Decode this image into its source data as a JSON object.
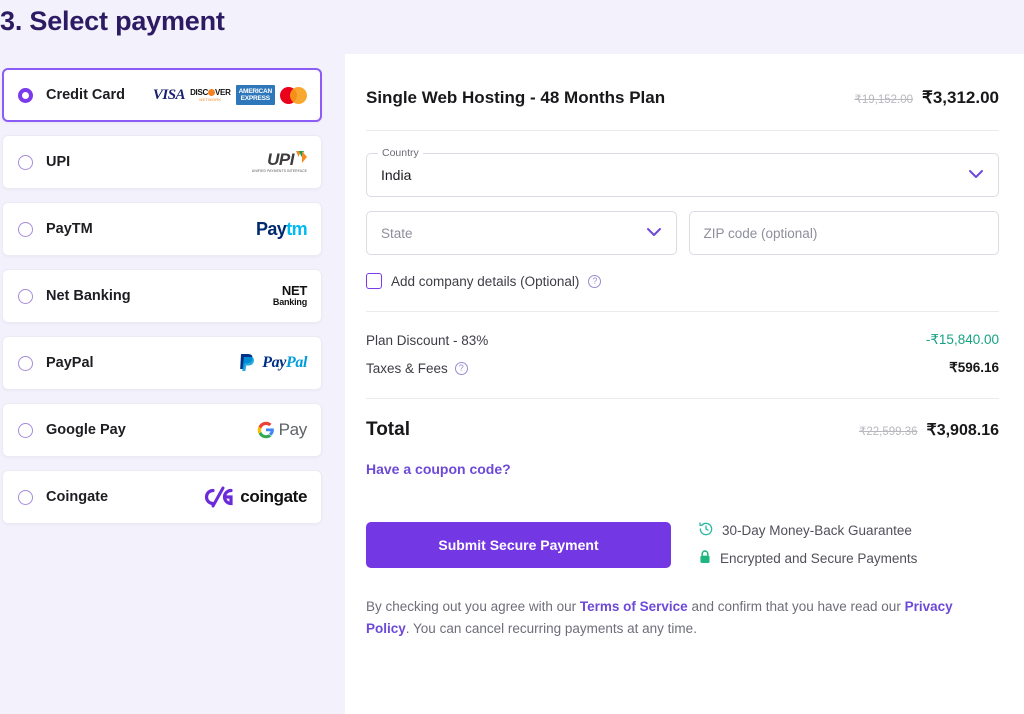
{
  "heading": "3. Select payment",
  "payment_methods": [
    {
      "label": "Credit Card",
      "selected": true,
      "logo": "credit-cards"
    },
    {
      "label": "UPI",
      "selected": false,
      "logo": "upi"
    },
    {
      "label": "PayTM",
      "selected": false,
      "logo": "paytm"
    },
    {
      "label": "Net Banking",
      "selected": false,
      "logo": "netbanking"
    },
    {
      "label": "PayPal",
      "selected": false,
      "logo": "paypal"
    },
    {
      "label": "Google Pay",
      "selected": false,
      "logo": "googlepay"
    },
    {
      "label": "Coingate",
      "selected": false,
      "logo": "coingate"
    }
  ],
  "card_logos": {
    "visa": "VISA",
    "discover_top": "DISC",
    "discover_top_end": "VER",
    "discover_sub": "NETWORK",
    "amex_line1": "AMERICAN",
    "amex_line2": "EXPRESS"
  },
  "method_logo_text": {
    "upi": "UPI",
    "upi_sub": "UNIFIED PAYMENTS INTERFACE",
    "paytm_part1": "Pay",
    "paytm_part2": "tm",
    "netbanking_line1": "NET",
    "netbanking_line2": "Banking",
    "paypal_part1": "Pay",
    "paypal_part2": "Pal",
    "googlepay_text": "Pay",
    "coingate_text": "coingate"
  },
  "order": {
    "plan_name": "Single Web Hosting - 48 Months Plan",
    "plan_price_old": "₹19,152.00",
    "plan_price_new": "₹3,312.00"
  },
  "form": {
    "country_label": "Country",
    "country_value": "India",
    "state_placeholder": "State",
    "zip_placeholder": "ZIP code (optional)",
    "company_checkbox_label": "Add company details (Optional)",
    "company_help": "?"
  },
  "summary": {
    "discount_label": "Plan Discount - 83%",
    "discount_value": "-₹15,840.00",
    "taxes_label": "Taxes & Fees",
    "taxes_help": "?",
    "taxes_value": "₹596.16",
    "total_label": "Total",
    "total_old": "₹22,599.36",
    "total_new": "₹3,908.16",
    "coupon_link": "Have a coupon code?"
  },
  "cta": {
    "submit_label": "Submit Secure Payment",
    "trust_money_back": "30-Day Money-Back Guarantee",
    "trust_encrypted": "Encrypted and Secure Payments"
  },
  "legal": {
    "part1": "By checking out you agree with our ",
    "terms": "Terms of Service",
    "part2": " and confirm that you have read our ",
    "privacy": "Privacy Policy",
    "part3": ". You can cancel recurring payments at any time."
  },
  "colors": {
    "accent": "#7337e4",
    "heading": "#2c1a63",
    "link": "#6d49d8",
    "green": "#16a382",
    "page_bg": "#f3f1fb"
  }
}
